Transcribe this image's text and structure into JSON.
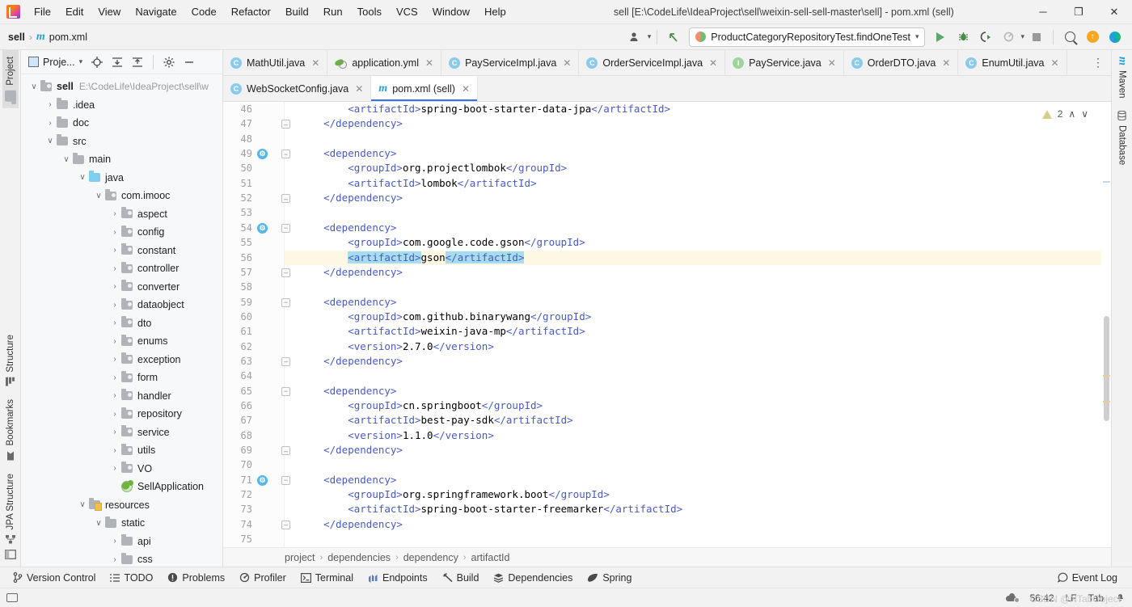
{
  "titlebar": {
    "menus": [
      "File",
      "Edit",
      "View",
      "Navigate",
      "Code",
      "Refactor",
      "Build",
      "Run",
      "Tools",
      "VCS",
      "Window",
      "Help"
    ],
    "window_title": "sell [E:\\CodeLife\\IdeaProject\\sell\\weixin-sell-sell-master\\sell] - pom.xml (sell)",
    "minimize": "─",
    "maximize": "❐",
    "close": "✕"
  },
  "navbar": {
    "crumb_project": "sell",
    "crumb_file": "pom.xml",
    "separator": "›",
    "maven_glyph": "m",
    "run_config": "ProductCategoryRepositoryTest.findOneTest",
    "dropdown_caret": "▾",
    "icons": {
      "profile": "user-profile-icon",
      "back_arrow": "↖",
      "run": "run-icon",
      "debug": "debug-icon",
      "run_coverage": "run-with-coverage-icon",
      "profiler": "profiler-icon",
      "stop": "stop-icon",
      "search": "search-icon",
      "updates": "↑",
      "ide_assistant": "ide-assistant-icon"
    }
  },
  "left_rail": {
    "tabs": [
      "Project",
      "Structure",
      "Bookmarks",
      "JPA Structure"
    ],
    "active": "Project"
  },
  "right_rail": {
    "tabs": [
      "Maven",
      "Database"
    ]
  },
  "project_panel": {
    "title": "Proje...",
    "caret": "▾",
    "icons": [
      "locate-icon",
      "expand-all-icon",
      "collapse-all-icon",
      "settings-gear-icon",
      "hide-icon"
    ],
    "tree": [
      {
        "indent": 0,
        "arrow": "⌄",
        "icon": "folder-module",
        "label": "sell",
        "bold": true,
        "path": "E:\\CodeLife\\IdeaProject\\sell\\w"
      },
      {
        "indent": 1,
        "arrow": "›",
        "icon": "folder",
        "label": ".idea",
        "bold": false,
        "path": ""
      },
      {
        "indent": 1,
        "arrow": "›",
        "icon": "folder",
        "label": "doc",
        "bold": false,
        "path": ""
      },
      {
        "indent": 1,
        "arrow": "⌄",
        "icon": "folder",
        "label": "src",
        "bold": false,
        "path": ""
      },
      {
        "indent": 2,
        "arrow": "⌄",
        "icon": "folder",
        "label": "main",
        "bold": false,
        "path": ""
      },
      {
        "indent": 3,
        "arrow": "⌄",
        "icon": "folder-source",
        "label": "java",
        "bold": false,
        "path": ""
      },
      {
        "indent": 4,
        "arrow": "⌄",
        "icon": "folder-package",
        "label": "com.imooc",
        "bold": false,
        "path": ""
      },
      {
        "indent": 5,
        "arrow": "›",
        "icon": "folder-package",
        "label": "aspect",
        "bold": false,
        "path": ""
      },
      {
        "indent": 5,
        "arrow": "›",
        "icon": "folder-package",
        "label": "config",
        "bold": false,
        "path": ""
      },
      {
        "indent": 5,
        "arrow": "›",
        "icon": "folder-package",
        "label": "constant",
        "bold": false,
        "path": ""
      },
      {
        "indent": 5,
        "arrow": "›",
        "icon": "folder-package",
        "label": "controller",
        "bold": false,
        "path": ""
      },
      {
        "indent": 5,
        "arrow": "›",
        "icon": "folder-package",
        "label": "converter",
        "bold": false,
        "path": ""
      },
      {
        "indent": 5,
        "arrow": "›",
        "icon": "folder-package",
        "label": "dataobject",
        "bold": false,
        "path": ""
      },
      {
        "indent": 5,
        "arrow": "›",
        "icon": "folder-package",
        "label": "dto",
        "bold": false,
        "path": ""
      },
      {
        "indent": 5,
        "arrow": "›",
        "icon": "folder-package",
        "label": "enums",
        "bold": false,
        "path": ""
      },
      {
        "indent": 5,
        "arrow": "›",
        "icon": "folder-package",
        "label": "exception",
        "bold": false,
        "path": ""
      },
      {
        "indent": 5,
        "arrow": "›",
        "icon": "folder-package",
        "label": "form",
        "bold": false,
        "path": ""
      },
      {
        "indent": 5,
        "arrow": "›",
        "icon": "folder-package",
        "label": "handler",
        "bold": false,
        "path": ""
      },
      {
        "indent": 5,
        "arrow": "›",
        "icon": "folder-package",
        "label": "repository",
        "bold": false,
        "path": ""
      },
      {
        "indent": 5,
        "arrow": "›",
        "icon": "folder-package",
        "label": "service",
        "bold": false,
        "path": ""
      },
      {
        "indent": 5,
        "arrow": "›",
        "icon": "folder-package",
        "label": "utils",
        "bold": false,
        "path": ""
      },
      {
        "indent": 5,
        "arrow": "›",
        "icon": "folder-package",
        "label": "VO",
        "bold": false,
        "path": ""
      },
      {
        "indent": 5,
        "arrow": "",
        "icon": "spring-boot-class",
        "label": "SellApplication",
        "bold": false,
        "path": ""
      },
      {
        "indent": 3,
        "arrow": "⌄",
        "icon": "folder-resources",
        "label": "resources",
        "bold": false,
        "path": ""
      },
      {
        "indent": 4,
        "arrow": "⌄",
        "icon": "folder",
        "label": "static",
        "bold": false,
        "path": ""
      },
      {
        "indent": 5,
        "arrow": "›",
        "icon": "folder",
        "label": "api",
        "bold": false,
        "path": ""
      },
      {
        "indent": 5,
        "arrow": "›",
        "icon": "folder",
        "label": "css",
        "bold": false,
        "path": ""
      }
    ]
  },
  "editor": {
    "tabs_row1": [
      {
        "label": "MathUtil.java",
        "icon": "class-icon",
        "close": "✕",
        "active": false
      },
      {
        "label": "application.yml",
        "icon": "spring-yaml-icon",
        "close": "✕",
        "active": false
      },
      {
        "label": "PayServiceImpl.java",
        "icon": "class-icon",
        "close": "✕",
        "active": false
      },
      {
        "label": "OrderServiceImpl.java",
        "icon": "class-icon",
        "close": "✕",
        "active": false
      },
      {
        "label": "PayService.java",
        "icon": "interface-icon",
        "close": "✕",
        "active": false
      },
      {
        "label": "OrderDTO.java",
        "icon": "class-icon",
        "close": "✕",
        "active": false
      },
      {
        "label": "EnumUtil.java",
        "icon": "class-icon",
        "close": "✕",
        "active": false
      }
    ],
    "tabs_overflow": "⋮",
    "tabs_row2": [
      {
        "label": "WebSocketConfig.java",
        "icon": "class-icon",
        "close": "✕",
        "active": false
      },
      {
        "label": "pom.xml (sell)",
        "icon": "maven-icon",
        "close": "✕",
        "active": true
      }
    ],
    "inspection": {
      "count": "2",
      "warn_icon": "warning-triangle-icon",
      "up": "∧",
      "down": "∨"
    },
    "breadcrumb": [
      "project",
      "dependencies",
      "dependency",
      "artifactId"
    ],
    "breadcrumb_sep": "›",
    "first_line_number": 46,
    "lines": [
      {
        "n": 46,
        "text": "        <artifactId>spring-boot-starter-data-jpa</artifactId>",
        "gutter": "",
        "fold": "",
        "hl": false
      },
      {
        "n": 47,
        "text": "    </dependency>",
        "gutter": "",
        "fold": "end",
        "hl": false
      },
      {
        "n": 48,
        "text": "",
        "gutter": "",
        "fold": "",
        "hl": false
      },
      {
        "n": 49,
        "text": "    <dependency>",
        "gutter": "bean",
        "fold": "start",
        "hl": false
      },
      {
        "n": 50,
        "text": "        <groupId>org.projectlombok</groupId>",
        "gutter": "",
        "fold": "",
        "hl": false
      },
      {
        "n": 51,
        "text": "        <artifactId>lombok</artifactId>",
        "gutter": "",
        "fold": "",
        "hl": false
      },
      {
        "n": 52,
        "text": "    </dependency>",
        "gutter": "",
        "fold": "end",
        "hl": false
      },
      {
        "n": 53,
        "text": "",
        "gutter": "",
        "fold": "",
        "hl": false
      },
      {
        "n": 54,
        "text": "    <dependency>",
        "gutter": "bean",
        "fold": "start",
        "hl": false
      },
      {
        "n": 55,
        "text": "        <groupId>com.google.code.gson</groupId>",
        "gutter": "",
        "fold": "",
        "hl": false
      },
      {
        "n": 56,
        "text": "        <artifactId>gson</artifactId>",
        "gutter": "bulb",
        "fold": "",
        "hl": true
      },
      {
        "n": 57,
        "text": "    </dependency>",
        "gutter": "",
        "fold": "end",
        "hl": false
      },
      {
        "n": 58,
        "text": "",
        "gutter": "",
        "fold": "",
        "hl": false
      },
      {
        "n": 59,
        "text": "    <dependency>",
        "gutter": "",
        "fold": "start",
        "hl": false
      },
      {
        "n": 60,
        "text": "        <groupId>com.github.binarywang</groupId>",
        "gutter": "",
        "fold": "",
        "hl": false
      },
      {
        "n": 61,
        "text": "        <artifactId>weixin-java-mp</artifactId>",
        "gutter": "",
        "fold": "",
        "hl": false
      },
      {
        "n": 62,
        "text": "        <version>2.7.0</version>",
        "gutter": "",
        "fold": "",
        "hl": false
      },
      {
        "n": 63,
        "text": "    </dependency>",
        "gutter": "",
        "fold": "end",
        "hl": false
      },
      {
        "n": 64,
        "text": "",
        "gutter": "",
        "fold": "",
        "hl": false
      },
      {
        "n": 65,
        "text": "    <dependency>",
        "gutter": "",
        "fold": "start",
        "hl": false
      },
      {
        "n": 66,
        "text": "        <groupId>cn.springboot</groupId>",
        "gutter": "",
        "fold": "",
        "hl": false
      },
      {
        "n": 67,
        "text": "        <artifactId>best-pay-sdk</artifactId>",
        "gutter": "",
        "fold": "",
        "hl": false
      },
      {
        "n": 68,
        "text": "        <version>1.1.0</version>",
        "gutter": "",
        "fold": "",
        "hl": false
      },
      {
        "n": 69,
        "text": "    </dependency>",
        "gutter": "",
        "fold": "end",
        "hl": false
      },
      {
        "n": 70,
        "text": "",
        "gutter": "",
        "fold": "",
        "hl": false
      },
      {
        "n": 71,
        "text": "    <dependency>",
        "gutter": "bean",
        "fold": "start",
        "hl": false
      },
      {
        "n": 72,
        "text": "        <groupId>org.springframework.boot</groupId>",
        "gutter": "",
        "fold": "",
        "hl": false
      },
      {
        "n": 73,
        "text": "        <artifactId>spring-boot-starter-freemarker</artifactId>",
        "gutter": "",
        "fold": "",
        "hl": false
      },
      {
        "n": 74,
        "text": "    </dependency>",
        "gutter": "",
        "fold": "end",
        "hl": false
      },
      {
        "n": 75,
        "text": "",
        "gutter": "",
        "fold": "",
        "hl": false
      }
    ],
    "selection_line": 56,
    "selection_text": "<artifactId>gson</artifactId>"
  },
  "bottom_toolwindows": [
    {
      "label": "Version Control",
      "icon": "branch-icon"
    },
    {
      "label": "TODO",
      "icon": "list-icon"
    },
    {
      "label": "Problems",
      "icon": "problems-icon"
    },
    {
      "label": "Profiler",
      "icon": "profiler-icon"
    },
    {
      "label": "Terminal",
      "icon": "terminal-icon"
    },
    {
      "label": "Endpoints",
      "icon": "endpoints-icon"
    },
    {
      "label": "Build",
      "icon": "hammer-icon"
    },
    {
      "label": "Dependencies",
      "icon": "dependencies-icon"
    },
    {
      "label": "Spring",
      "icon": "spring-leaf-icon"
    }
  ],
  "event_log": {
    "label": "Event Log",
    "icon": "event-log-icon"
  },
  "statusbar": {
    "left_icon": "layout-icon",
    "caret_position": "56:42",
    "line_separator": "LF",
    "indent": "Tab",
    "inspections_icon": "inspections-widget-icon",
    "encoding_hidden": "",
    "watermark": "CSDN @NTabObject"
  },
  "colors": {
    "accent": "#3574f0",
    "tag": "#4a5bbf",
    "selection": "#a6dcf0",
    "highlight_line": "#fdf8e3",
    "run_green": "#59a869",
    "bulb": "#f5b325"
  }
}
